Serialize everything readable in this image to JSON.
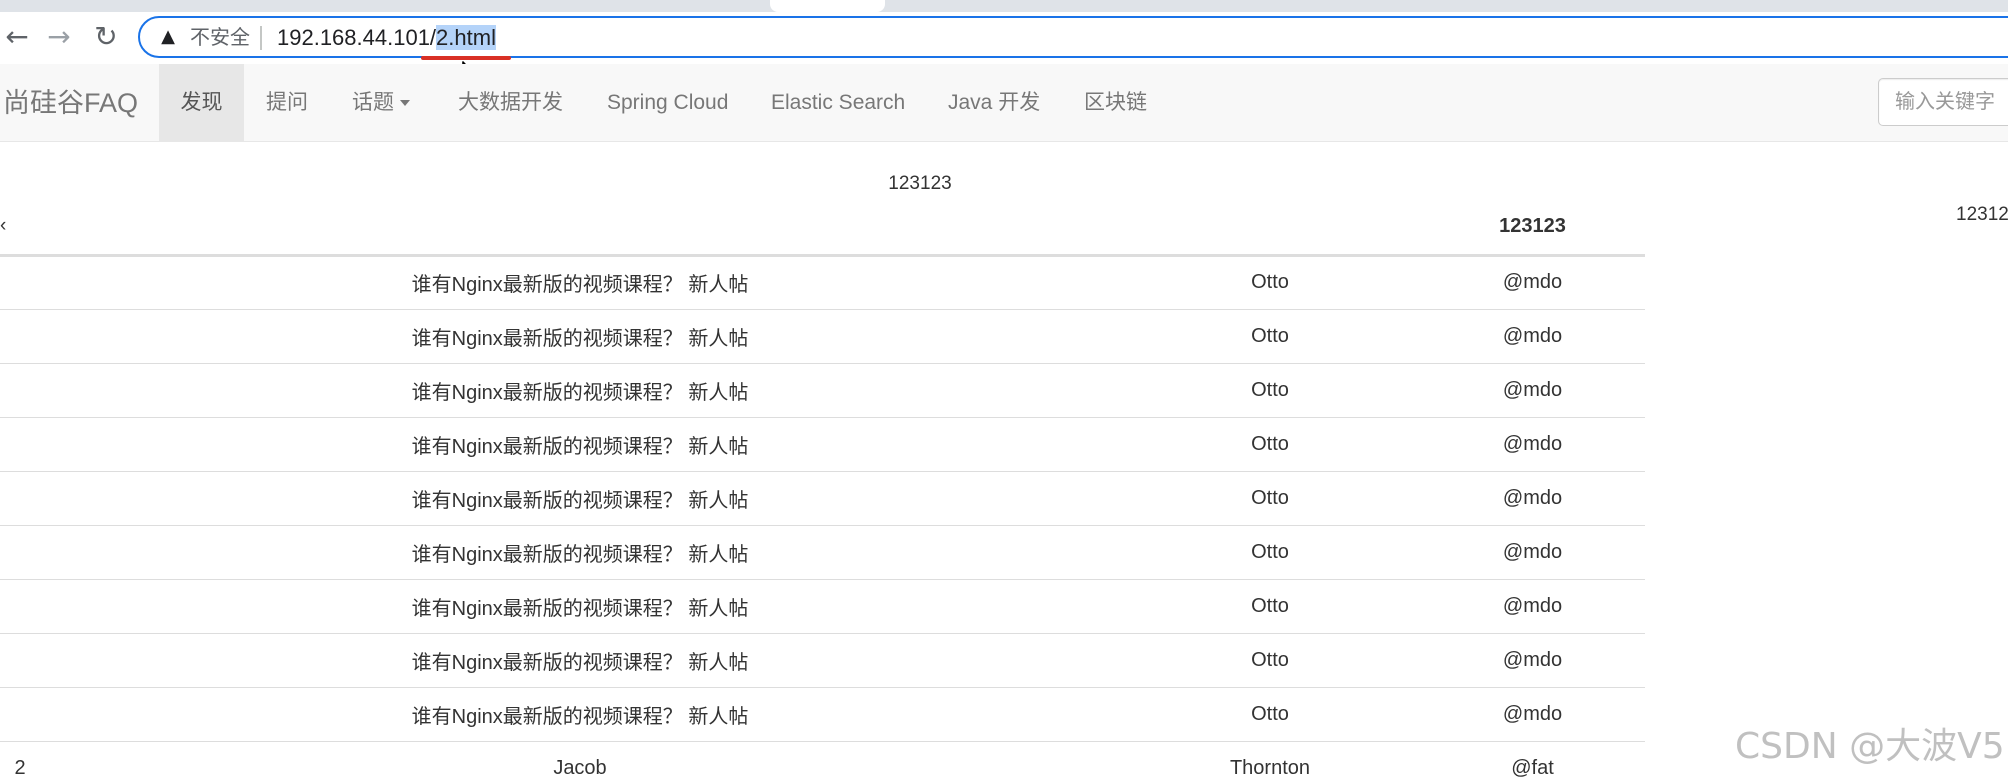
{
  "browser": {
    "back_icon": "←",
    "forward_icon": "→",
    "reload_icon": "↻",
    "warning_icon": "▲",
    "security_label": "不安全",
    "url_host": "192.168.44.101/",
    "url_path_selected": "2.html"
  },
  "navbar": {
    "brand": "尚硅谷FAQ",
    "items": [
      {
        "label": "发现"
      },
      {
        "label": "提问"
      },
      {
        "label": "话题"
      },
      {
        "label": "大数据开发"
      },
      {
        "label": "Spring Cloud"
      },
      {
        "label": "Elastic Search"
      },
      {
        "label": "Java 开发"
      },
      {
        "label": "区块链"
      }
    ],
    "search_placeholder": "输入关键字"
  },
  "content": {
    "caption": "123123",
    "right_text": "12312",
    "cut_glyph": "‹",
    "table": {
      "header": [
        "",
        "",
        "",
        "123123"
      ],
      "rows": [
        {
          "index": "",
          "title": "谁有Nginx最新版的视频课程？ 新人帖",
          "name": "Otto",
          "handle": "@mdo"
        },
        {
          "index": "",
          "title": "谁有Nginx最新版的视频课程？ 新人帖",
          "name": "Otto",
          "handle": "@mdo"
        },
        {
          "index": "",
          "title": "谁有Nginx最新版的视频课程？ 新人帖",
          "name": "Otto",
          "handle": "@mdo"
        },
        {
          "index": "",
          "title": "谁有Nginx最新版的视频课程？ 新人帖",
          "name": "Otto",
          "handle": "@mdo"
        },
        {
          "index": "",
          "title": "谁有Nginx最新版的视频课程？ 新人帖",
          "name": "Otto",
          "handle": "@mdo"
        },
        {
          "index": "",
          "title": "谁有Nginx最新版的视频课程？ 新人帖",
          "name": "Otto",
          "handle": "@mdo"
        },
        {
          "index": "",
          "title": "谁有Nginx最新版的视频课程？ 新人帖",
          "name": "Otto",
          "handle": "@mdo"
        },
        {
          "index": "",
          "title": "谁有Nginx最新版的视频课程？ 新人帖",
          "name": "Otto",
          "handle": "@mdo"
        },
        {
          "index": "",
          "title": "谁有Nginx最新版的视频课程？ 新人帖",
          "name": "Otto",
          "handle": "@mdo"
        },
        {
          "index": "2",
          "title": "Jacob",
          "name": "Thornton",
          "handle": "@fat"
        }
      ]
    }
  },
  "watermark": "CSDN @大波V5",
  "colors": {
    "omnibox_focus": "#1a73e8",
    "url_selection": "#b4d3f9",
    "annotation_red": "#d93025",
    "navbar_bg": "#f8f8f8",
    "nav_active_bg": "#e7e7e7"
  }
}
